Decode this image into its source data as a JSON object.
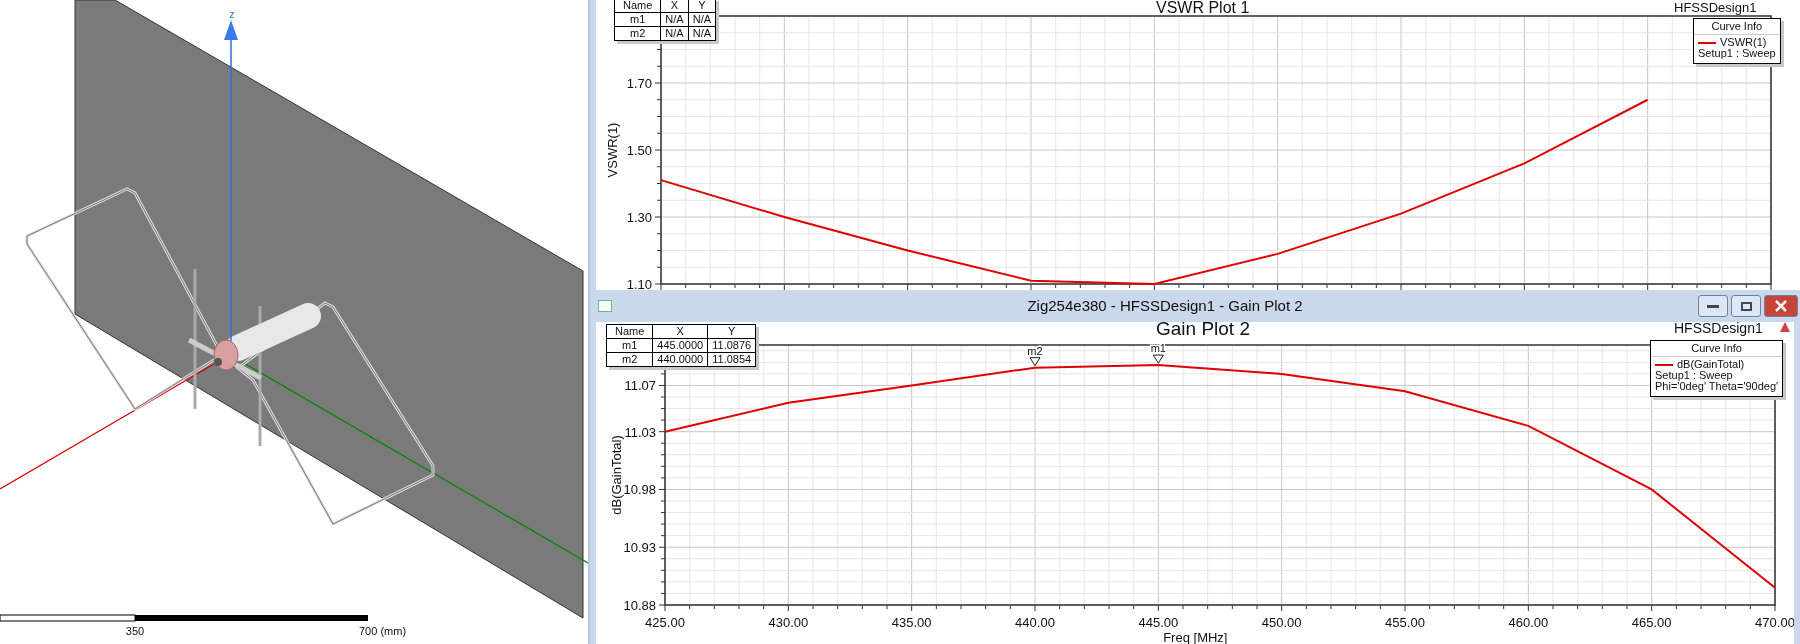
{
  "view_3d": {
    "axis_label": "z",
    "scale_bar": {
      "labels": [
        "350",
        "700 (mm)"
      ]
    }
  },
  "vswr_window": {
    "title": "VSWR Plot 1",
    "design": "HFSSDesign1",
    "marker_table": {
      "columns": [
        "Name",
        "X",
        "Y"
      ],
      "rows": [
        [
          "m1",
          "N/A",
          "N/A"
        ],
        [
          "m2",
          "N/A",
          "N/A"
        ]
      ]
    },
    "legend": {
      "title": "Curve Info",
      "lines": [
        "Setup1 : Sweep"
      ]
    },
    "chart_data": {
      "type": "line",
      "ylabel": "VSWR(1)",
      "x": [
        425,
        430,
        435,
        440,
        445,
        450,
        455,
        460,
        465
      ],
      "series": [
        {
          "name": "VSWR(1)",
          "color": "#e00000",
          "values": [
            1.41,
            1.3,
            1.2,
            1.11,
            1.1,
            1.19,
            1.31,
            1.46,
            1.65
          ]
        }
      ],
      "xlim": [
        425,
        470
      ],
      "ylim": [
        1.1,
        1.9
      ],
      "grid": true,
      "yticks": [
        {
          "value": 1.1,
          "label": "1.10"
        },
        {
          "value": 1.3,
          "label": "1.30"
        },
        {
          "value": 1.5,
          "label": "1.50"
        },
        {
          "value": 1.7,
          "label": "1.70"
        }
      ]
    }
  },
  "gain_window": {
    "window_title": "Zig254e380 - HFSSDesign1 - Gain Plot 2",
    "title": "Gain Plot 2",
    "design": "HFSSDesign1",
    "marker_table": {
      "columns": [
        "Name",
        "X",
        "Y"
      ],
      "rows": [
        [
          "m1",
          "445.0000",
          "11.0876"
        ],
        [
          "m2",
          "440.0000",
          "11.0854"
        ]
      ]
    },
    "legend": {
      "title": "Curve Info",
      "lines": [
        "Setup1 : Sweep",
        "Phi='0deg' Theta='90deg'"
      ]
    },
    "chart_data": {
      "type": "line",
      "xlabel": "Freq [MHz]",
      "ylabel": "dB(GainTotal)",
      "x": [
        425,
        430,
        435,
        440,
        445,
        450,
        455,
        460,
        465,
        470
      ],
      "series": [
        {
          "name": "dB(GainTotal)",
          "color": "#e00000",
          "values": [
            11.03,
            11.055,
            11.07,
            11.0854,
            11.0876,
            11.08,
            11.065,
            11.035,
            10.98,
            10.895
          ]
        }
      ],
      "xlim": [
        425,
        470
      ],
      "ylim": [
        10.88,
        11.105
      ],
      "grid": true,
      "xticks": [
        {
          "value": 425,
          "label": "425.00"
        },
        {
          "value": 430,
          "label": "430.00"
        },
        {
          "value": 435,
          "label": "435.00"
        },
        {
          "value": 440,
          "label": "440.00"
        },
        {
          "value": 445,
          "label": "445.00"
        },
        {
          "value": 450,
          "label": "450.00"
        },
        {
          "value": 455,
          "label": "455.00"
        },
        {
          "value": 460,
          "label": "460.00"
        },
        {
          "value": 465,
          "label": "465.00"
        },
        {
          "value": 470,
          "label": "470.00"
        }
      ],
      "yticks": [
        {
          "value": 10.88,
          "label": "10.88"
        },
        {
          "value": 10.93,
          "label": "10.93"
        },
        {
          "value": 10.98,
          "label": "10.98"
        },
        {
          "value": 11.03,
          "label": "11.03"
        },
        {
          "value": 11.07,
          "label": "11.07"
        }
      ],
      "annotations": [
        {
          "x": 440,
          "y": 11.0854,
          "text": "m2"
        },
        {
          "x": 445,
          "y": 11.0876,
          "text": "m1"
        }
      ]
    }
  }
}
